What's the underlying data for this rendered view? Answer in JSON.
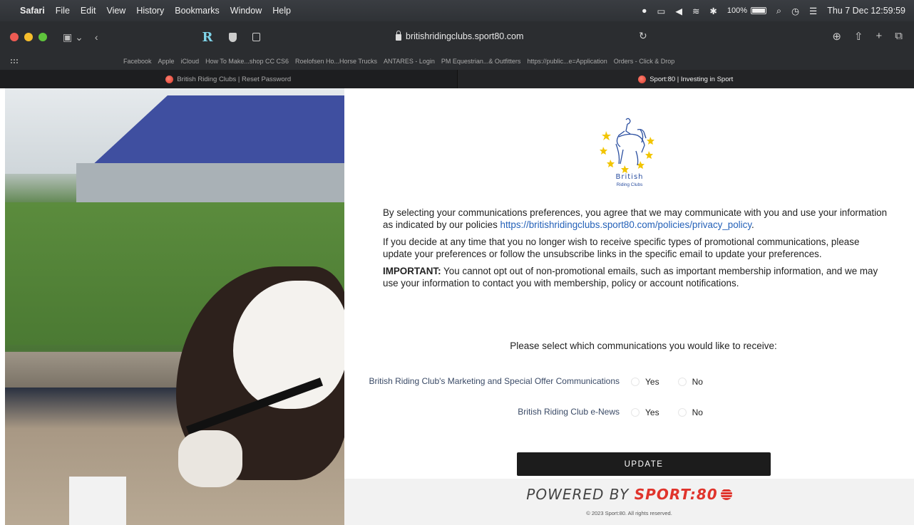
{
  "menubar": {
    "app": "Safari",
    "items": [
      "File",
      "Edit",
      "View",
      "History",
      "Bookmarks",
      "Window",
      "Help"
    ],
    "battery": "100%",
    "clock": "Thu 7 Dec  12:59:59"
  },
  "toolbar": {
    "url": "britishridingclubs.sport80.com"
  },
  "favorites": [
    "Facebook",
    "Apple",
    "iCloud",
    "How To Make...shop CC CS6",
    "Roelofsen Ho...Horse Trucks",
    "ANTARES - Login",
    "PM Equestrian...& Outfitters",
    "https://public...e=Application",
    "Orders - Click & Drop"
  ],
  "tabs": [
    {
      "title": "British Riding Clubs | Reset Password",
      "active": false
    },
    {
      "title": "Sport:80 | Investing in Sport",
      "active": true
    }
  ],
  "logo": {
    "line1": "British",
    "line2": "Riding Clubs"
  },
  "policy": {
    "p1_text": "By selecting your communications preferences, you agree that we may communicate with you and use your information as indicated by our policies ",
    "p1_link": "https://britishridingclubs.sport80.com/policies/privacy_policy",
    "p1_end": ".",
    "p2": "If you decide at any time that you no longer wish to receive specific types of promotional communications, please update your preferences or follow the unsubscribe links in the specific email to update your preferences.",
    "p3_strong": "IMPORTANT:",
    "p3": " You cannot opt out of non-promotional emails, such as important membership information, and we may use your information to contact you with membership, policy or account notifications."
  },
  "preferences": {
    "title": "Please select which communications you would like to receive:",
    "rows": [
      {
        "label": "British Riding Club's Marketing and Special Offer Communications",
        "yes": "Yes",
        "no": "No"
      },
      {
        "label": "British Riding Club e-News",
        "yes": "Yes",
        "no": "No"
      }
    ]
  },
  "update_label": "UPDATE",
  "footer": {
    "powered_prefix": "POWERED BY ",
    "powered_brand": "SPORT:80",
    "copyright": "© 2023 Sport:80. All rights reserved."
  }
}
